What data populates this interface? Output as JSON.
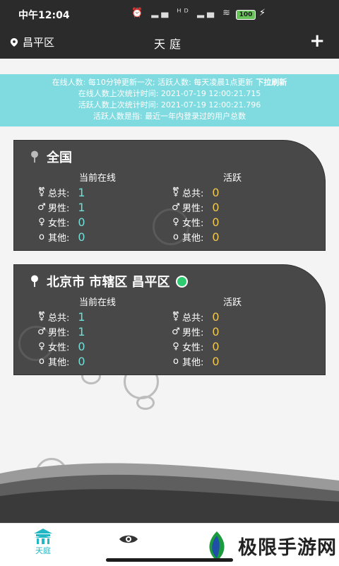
{
  "status_bar": {
    "time": "中午12:04",
    "indicators": "⏰ ▂▄ ᴴᴰ ▂▄ ≋",
    "battery": "100"
  },
  "app_bar": {
    "location": "昌平区",
    "title": "天庭",
    "add_label": "+"
  },
  "notice": {
    "line1": "在线人数: 每10分钟更新一次; 活跃人数: 每天凌晨1点更新",
    "pull_refresh": "下拉刷新",
    "line2": "在线人数上次统计时间: 2021-07-19 12:00:21.715",
    "line3": "活跃人数上次统计时间: 2021-07-19 12:00:21.796",
    "line4": "活跃人数是指: 最近一年内登录过的用户总数"
  },
  "cards": [
    {
      "title": "全国",
      "col_online": "当前在线",
      "col_active": "活跃",
      "online": {
        "total_label": "总共:",
        "total": "1",
        "male_label": "男性:",
        "male": "1",
        "female_label": "女性:",
        "female": "0",
        "other_label": "其他:",
        "other": "0"
      },
      "active": {
        "total_label": "总共:",
        "total": "0",
        "male_label": "男性:",
        "male": "0",
        "female_label": "女性:",
        "female": "0",
        "other_label": "其他:",
        "other": "0"
      }
    },
    {
      "title": "北京市 市辖区 昌平区",
      "col_online": "当前在线",
      "col_active": "活跃",
      "online": {
        "total_label": "总共:",
        "total": "1",
        "male_label": "男性:",
        "male": "1",
        "female_label": "女性:",
        "female": "0",
        "other_label": "其他:",
        "other": "0"
      },
      "active": {
        "total_label": "总共:",
        "total": "0",
        "male_label": "男性:",
        "male": "0",
        "female_label": "女性:",
        "female": "0",
        "other_label": "其他:",
        "other": "0"
      }
    }
  ],
  "symbols": {
    "total": "⚧",
    "male": "♂",
    "female": "♀",
    "other": "o"
  },
  "bottom_nav": {
    "tab_home_label": "天庭"
  },
  "watermark": {
    "text": "极限手游网"
  },
  "colors": {
    "header": "#2b2b2b",
    "notice_bg": "#7fdbe0",
    "card_bg": "#484848",
    "online_value": "#6fe0d8",
    "active_value": "#f2c94c",
    "online_dot": "#2ecc71",
    "tab_active": "#22b7c4"
  }
}
